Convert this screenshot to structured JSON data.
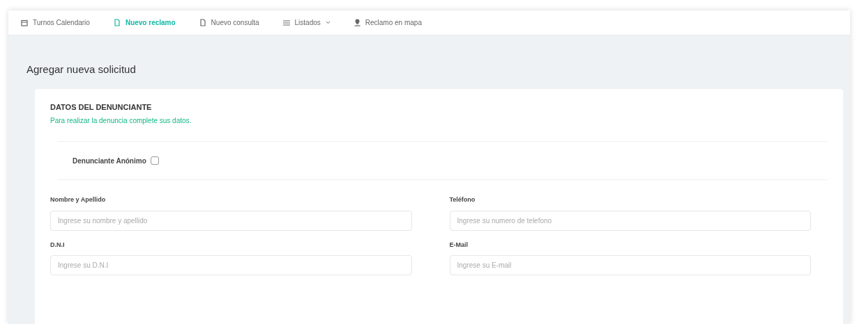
{
  "nav": [
    {
      "kind": "calendar",
      "label": "Turnos Calendario",
      "selected": false,
      "dropdown": false
    },
    {
      "kind": "doc",
      "label": "Nuevo reclamo",
      "selected": true,
      "dropdown": false
    },
    {
      "kind": "doc",
      "label": "Nuevo consulta",
      "selected": false,
      "dropdown": false
    },
    {
      "kind": "list",
      "label": "Listados",
      "selected": false,
      "dropdown": true
    },
    {
      "kind": "pin",
      "label": "Reclamo en mapa",
      "selected": false,
      "dropdown": false
    }
  ],
  "page_title": "Agregar nueva solicitud",
  "section": {
    "title": "DATOS DEL DENUNCIANTE",
    "subtitle": "Para realizar la denuncia complete sus datos."
  },
  "anonymous": {
    "label": "Denunciante Anónimo",
    "checked": false
  },
  "fields": [
    {
      "label": "Nombre y Apellido",
      "placeholder": "Ingrese su nombre y apellido"
    },
    {
      "label": "Teléfono",
      "placeholder": "Ingrese su numero de telefono"
    },
    {
      "label": "D.N.I",
      "placeholder": "Ingrese su D.N.I"
    },
    {
      "label": "E-Mail",
      "placeholder": "Ingrese su E-mail"
    }
  ]
}
